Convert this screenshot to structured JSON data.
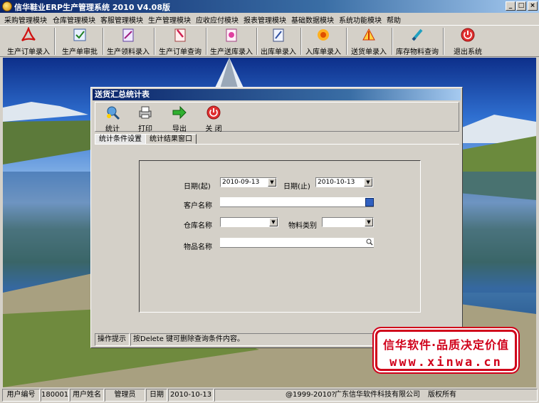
{
  "window": {
    "title": "信华鞋业ERP生产管理系统  2010 V4.08版",
    "minimize_glyph": "_",
    "maximize_glyph": "□",
    "close_glyph": "×"
  },
  "menu": [
    "采购管理模块",
    "仓库管理模块",
    "客服管理模块",
    "生产管理模块",
    "应收应付模块",
    "报表管理模块",
    "基础数据模块",
    "系统功能模块",
    "帮助"
  ],
  "toolbar": [
    {
      "label": "生产订单录入",
      "icon": "pdf-icon"
    },
    {
      "label": "生产单审批",
      "icon": "approve-icon"
    },
    {
      "label": "生产领料录入",
      "icon": "material-icon"
    },
    {
      "label": "生产订单查询",
      "icon": "order-query-icon"
    },
    {
      "label": "生产送库录入",
      "icon": "store-icon"
    },
    {
      "label": "出库单录入",
      "icon": "outbound-icon"
    },
    {
      "label": "入库单录入",
      "icon": "inbound-icon"
    },
    {
      "label": "送货单录入",
      "icon": "delivery-icon"
    },
    {
      "label": "库存物料查询",
      "icon": "stock-icon"
    },
    {
      "label": "退出系统",
      "icon": "exit-icon"
    }
  ],
  "child_window": {
    "title": "送货汇总统计表",
    "tools": [
      {
        "label": "统计",
        "icon": "stats-icon"
      },
      {
        "label": "打印",
        "icon": "printer-icon"
      },
      {
        "label": "导出",
        "icon": "export-arrow-icon"
      },
      {
        "label": "关 闭",
        "icon": "power-icon"
      }
    ],
    "tabs": [
      "统计条件设置",
      "统计结果窗口"
    ],
    "form": {
      "date_from_label": "日期(起)",
      "date_from_value": "2010-09-13",
      "date_to_label": "日期(止)",
      "date_to_value": "2010-10-13",
      "customer_label": "客户名称",
      "customer_value": "",
      "warehouse_label": "仓库名称",
      "warehouse_value": "",
      "material_type_label": "物料类别",
      "material_type_value": "",
      "item_label": "物品名称",
      "item_value": ""
    },
    "status": {
      "hint_label": "操作提示",
      "hint_text": "按Delete 键可删除查询条件内容。"
    }
  },
  "banner": {
    "line1": "信华软件·品质决定价值",
    "line2": "www.xinwa.cn"
  },
  "statusbar": {
    "user_id_label": "用户编号",
    "user_id": "180001",
    "user_name_label": "用户姓名",
    "user_name": "管理员",
    "date_label": "日期",
    "date": "2010-10-13",
    "copyright": "@1999-2010?",
    "company": "广东信华软件科技有限公司",
    "rights": "版权所有"
  },
  "colors": {
    "titlebar": "#0a246a",
    "face": "#d4d0c8",
    "brand_red": "#d0001a"
  }
}
